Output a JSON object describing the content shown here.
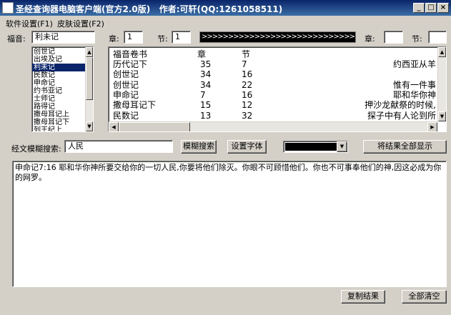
{
  "window": {
    "title": "圣经查询器电脑客户端(官方2.0版)   作者:可轩(QQ:1261058511)"
  },
  "menu": {
    "items": [
      "软件设置(F1)",
      "皮肤设置(F2)"
    ]
  },
  "query": {
    "gospel_label": "福音:",
    "gospel_value": "利未记",
    "chapter_label": "章:",
    "chapter_value": "1",
    "verse_label": "节:",
    "verse_value": "1",
    "progress_text": ">>>>>>>>>>>>>>>>>>>>>>>>>>>>>>>>>>>>>>>>>>>>>>>>>>>>>>>>>>>>",
    "chapter2_label": "章:",
    "chapter2_value": "",
    "verse2_label": "节:",
    "verse2_value": ""
  },
  "book_list": {
    "items": [
      "创世记",
      "出埃及记",
      "利未记",
      "民数记",
      "申命记",
      "约书亚记",
      "士师记",
      "路得记",
      "撒母耳记上",
      "撒母耳记下",
      "列王纪上"
    ],
    "selected_index": 2
  },
  "results_table": {
    "headers": [
      "福音卷书",
      "章",
      "节"
    ],
    "rows": [
      {
        "book": "历代记下",
        "chapter": "35",
        "verse": "7",
        "text": "约西亚从羊"
      },
      {
        "book": "创世记",
        "chapter": "34",
        "verse": "16",
        "text": ""
      },
      {
        "book": "创世记",
        "chapter": "34",
        "verse": "22",
        "text": "惟有一件事"
      },
      {
        "book": "申命记",
        "chapter": "7",
        "verse": "16",
        "text": "耶和华你神"
      },
      {
        "book": "撒母耳记下",
        "chapter": "15",
        "verse": "12",
        "text": "押沙龙献祭的时候,"
      },
      {
        "book": "民数记",
        "chapter": "13",
        "verse": "32",
        "text": "探子中有人论到所"
      }
    ]
  },
  "search": {
    "label": "经文模糊搜索:",
    "value": "人民",
    "fuzzy_button": "模糊搜索",
    "font_button": "设置字体",
    "show_all_button": "将结果全部显示"
  },
  "result_text": "申命记7:16 耶和华你神所要交给你的一切人民,你要将他们除灭。你眼不可顾惜他们。你也不可事奉他们的神,因这必成为你的网罗。",
  "footer": {
    "copy_button": "复制结果",
    "clear_button": "全部清空"
  },
  "colors": {
    "title_start": "#0a246a",
    "title_end": "#3a6ea5",
    "face": "#d4d0c8",
    "selection": "#0a246a"
  }
}
